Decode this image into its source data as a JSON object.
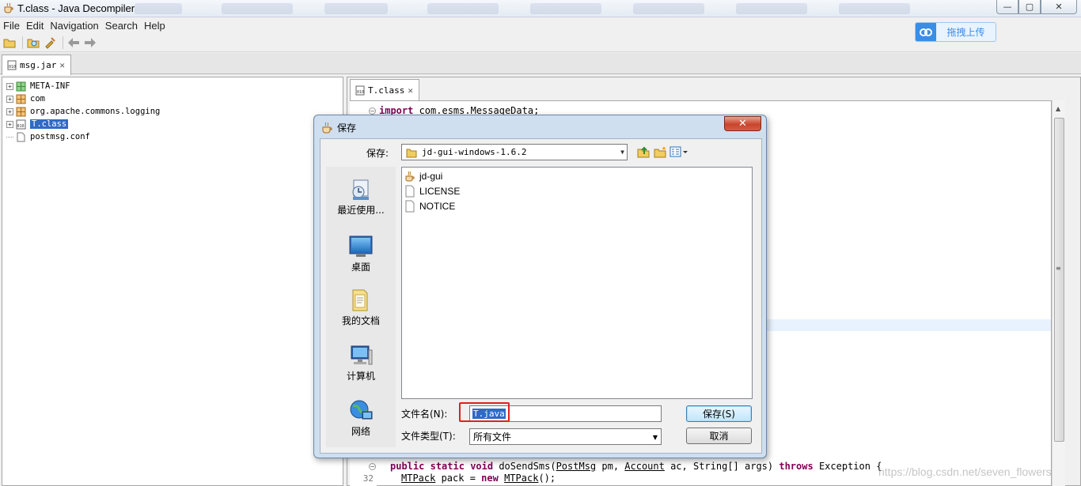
{
  "window": {
    "title": "T.class - Java Decompiler",
    "controls": {
      "minimize": "—",
      "maximize": "▢",
      "close": "✕"
    }
  },
  "menu": [
    "File",
    "Edit",
    "Navigation",
    "Search",
    "Help"
  ],
  "upload_button": {
    "label": "拖拽上传"
  },
  "jar_tab": {
    "label": "msg.jar",
    "close": "✕"
  },
  "tree": {
    "items": [
      {
        "label": "META-INF",
        "type": "package"
      },
      {
        "label": "com",
        "type": "package"
      },
      {
        "label": "org.apache.commons.logging",
        "type": "package"
      },
      {
        "label": "T.class",
        "type": "class",
        "selected": true
      },
      {
        "label": "postmsg.conf",
        "type": "file"
      }
    ]
  },
  "code_tab": {
    "label": "T.class",
    "close": "✕"
  },
  "code": {
    "import_kw": "import",
    "import_line": " com.esms.MessageData;",
    "method_public": "public",
    "method_static": "static",
    "method_void": "void",
    "method_name": " doSendSms(",
    "param_type1": "PostMsg",
    "param_name1": " pm, ",
    "param_type2": "Account",
    "param_name2": " ac, String[] args) ",
    "throws_kw": "throws",
    "throws_rest": " Exception {",
    "line_32_number": "32",
    "line_32_type": "MTPack",
    "line_32_mid": " pack = ",
    "line_32_new": "new",
    "line_32_sp": " ",
    "line_32_ctor": "MTPack",
    "line_32_end": "();"
  },
  "watermark": "https://blog.csdn.net/seven_flowers",
  "dialog": {
    "title": "保存",
    "close": "✕",
    "look_in_label": "保存:",
    "look_in_value": "jd-gui-windows-1.6.2",
    "places": [
      {
        "label": "最近使用...",
        "icon": "recent-icon"
      },
      {
        "label": "桌面",
        "icon": "desktop-icon"
      },
      {
        "label": "我的文档",
        "icon": "documents-icon"
      },
      {
        "label": "计算机",
        "icon": "computer-icon"
      },
      {
        "label": "网络",
        "icon": "network-icon"
      }
    ],
    "files": [
      {
        "label": "jd-gui",
        "icon": "app-icon"
      },
      {
        "label": "LICENSE",
        "icon": "file-icon"
      },
      {
        "label": "NOTICE",
        "icon": "file-icon"
      }
    ],
    "file_name_label": "文件名(N):",
    "file_name_value": "T.java",
    "file_type_label": "文件类型(T):",
    "file_type_value": "所有文件",
    "save_button": "保存(S)",
    "cancel_button": "取消"
  },
  "colors": {
    "selection": "#3169c6",
    "keyword": "#7f0055",
    "highlight_box": "#e02020"
  }
}
